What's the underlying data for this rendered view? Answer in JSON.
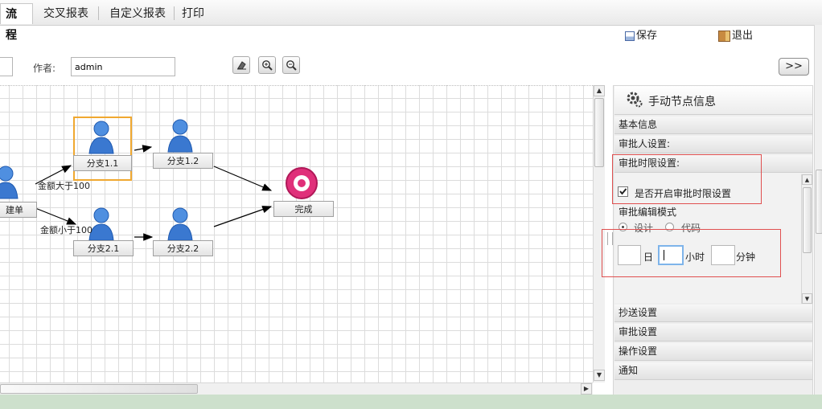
{
  "tabs": [
    {
      "label": "流程",
      "active": true
    },
    {
      "label": "交叉报表",
      "active": false
    },
    {
      "label": "自定义报表",
      "active": false
    },
    {
      "label": "打印",
      "active": false
    }
  ],
  "toolbar": {
    "save_label": "保存",
    "exit_label": "退出"
  },
  "form": {
    "author_label": "作者:",
    "author_value": "admin"
  },
  "nav": {
    "expand_label": ">>"
  },
  "workflow": {
    "nodes": [
      {
        "label": "建单"
      },
      {
        "label": "分支1.1"
      },
      {
        "label": "分支1.2"
      },
      {
        "label": "分支2.1"
      },
      {
        "label": "分支2.2"
      },
      {
        "label": "完成"
      }
    ],
    "edge_labels": [
      "金额大于100",
      "金额小于100"
    ]
  },
  "panel": {
    "title": "手动节点信息",
    "sections": {
      "basic": "基本信息",
      "approver": "审批人设置:",
      "time_limit": "审批时限设置:",
      "cc": "抄送设置",
      "approval": "审批设置",
      "operation": "操作设置",
      "notify": "通知"
    },
    "enable_label": "是否开启审批时限设置",
    "enable_checked": true,
    "edit_mode_label": "审批编辑模式",
    "mode_design": "设计",
    "mode_code": "代码",
    "selected_mode": "设计",
    "day_label": "日",
    "hour_label": "小时",
    "minute_label": "分钟"
  },
  "colors": {
    "highlight_border": "#f0a830",
    "red_annotation": "#e05050",
    "footer_bg": "#cde0cc"
  }
}
